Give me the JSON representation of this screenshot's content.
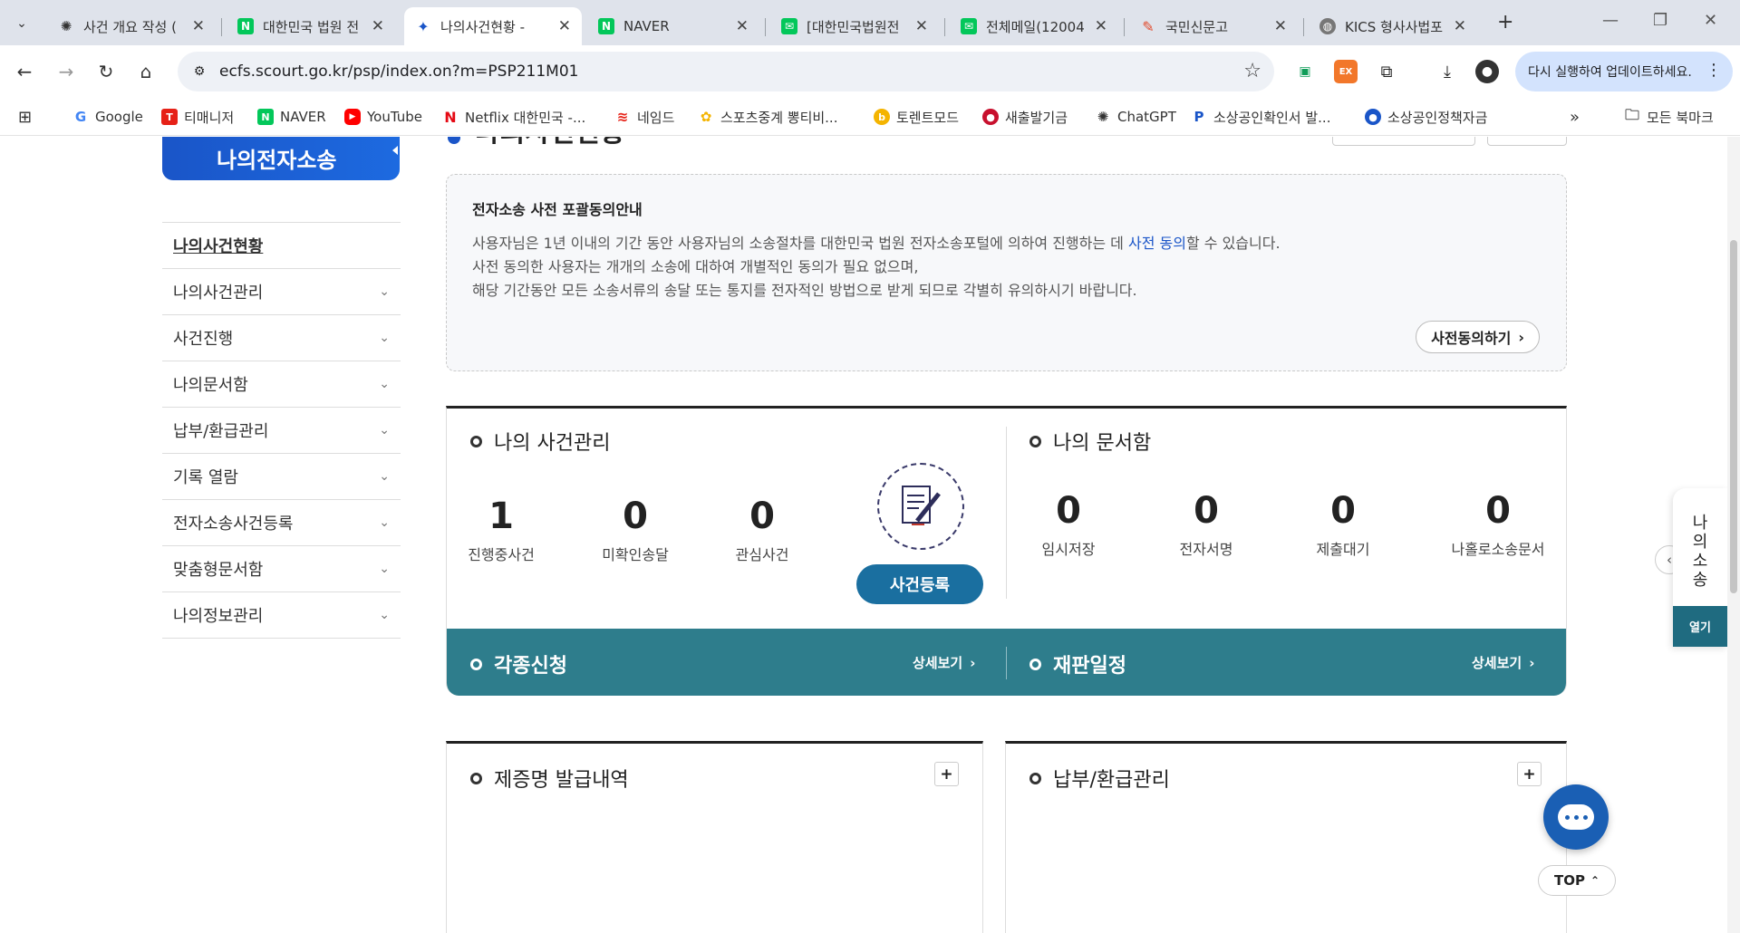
{
  "browser": {
    "tabs": [
      {
        "title": "사건 개요 작성 (",
        "icon": "openai-icon",
        "active": false
      },
      {
        "title": "대한민국 법원 전",
        "icon": "naver-n-icon",
        "active": false
      },
      {
        "title": "나의사건현황 - ",
        "icon": "court-logo-icon",
        "active": true
      },
      {
        "title": "NAVER",
        "icon": "naver-n-icon",
        "active": false
      },
      {
        "title": "[대한민국법원전",
        "icon": "naver-mail-icon",
        "active": false
      },
      {
        "title": "전체메일(12004",
        "icon": "naver-mail-icon",
        "active": false
      },
      {
        "title": "국민신문고",
        "icon": "petition-icon",
        "active": false
      },
      {
        "title": "KICS 형사사법포",
        "icon": "globe-icon",
        "active": false
      }
    ],
    "url": "ecfs.scourt.go.kr/psp/index.on?m=PSP211M01",
    "update_label": "다시 실행하여 업데이트하세요.",
    "bookmarks": [
      {
        "label": "Google",
        "icon": "google-icon"
      },
      {
        "label": "티매니저",
        "icon": "t-icon"
      },
      {
        "label": "NAVER",
        "icon": "naver-n-icon"
      },
      {
        "label": "YouTube",
        "icon": "youtube-icon"
      },
      {
        "label": "Netflix 대한민국 -...",
        "icon": "netflix-icon"
      },
      {
        "label": "네임드",
        "icon": "named-icon"
      },
      {
        "label": "스포츠중계 뽕티비...",
        "icon": "sports-icon"
      },
      {
        "label": "토렌트모드",
        "icon": "torrent-icon"
      },
      {
        "label": "새출발기금",
        "icon": "korea-emblem-icon"
      },
      {
        "label": "ChatGPT",
        "icon": "openai-icon"
      },
      {
        "label": "소상공인확인서 발...",
        "icon": "p-icon"
      },
      {
        "label": "소상공인정책자금",
        "icon": "policy-icon"
      }
    ],
    "all_bookmarks": "모든 북마크"
  },
  "sidebar": {
    "title": "나의전자소송",
    "items": [
      {
        "label": "나의사건현황",
        "current": true
      },
      {
        "label": "나의사건관리"
      },
      {
        "label": "사건진행"
      },
      {
        "label": "나의문서함"
      },
      {
        "label": "납부/환급관리"
      },
      {
        "label": "기록 열람"
      },
      {
        "label": "전자소송사건등록"
      },
      {
        "label": "맞춤형문서함"
      },
      {
        "label": "나의정보관리"
      }
    ]
  },
  "main": {
    "page_title": "나의사건현황",
    "consent": {
      "title": "전자소송 사전 포괄동의안내",
      "line1_pre": "사용자님은 1년 이내의 기간 동안 사용자님의 소송절차를 대한민국 법원 전자소송포털에 의하여 진행하는 데 ",
      "line1_link": "사전 동의",
      "line1_post": "할 수 있습니다.",
      "line2": "사전 동의한 사용자는 개개의 소송에 대하여 개별적인 동의가 필요 없으며,",
      "line3": "해당 기간동안 모든 소송서류의 송달 또는 통지를 전자적인 방법으로 받게 되므로 각별히 유의하시기 바랍니다.",
      "button": "사전동의하기"
    },
    "my_cases": {
      "title": "나의 사건관리",
      "stats": [
        {
          "value": "1",
          "label": "진행중사건"
        },
        {
          "value": "0",
          "label": "미확인송달"
        },
        {
          "value": "0",
          "label": "관심사건"
        }
      ],
      "register_button": "사건등록"
    },
    "my_docs": {
      "title": "나의 문서함",
      "stats": [
        {
          "value": "0",
          "label": "임시저장"
        },
        {
          "value": "0",
          "label": "전자서명"
        },
        {
          "value": "0",
          "label": "제출대기"
        },
        {
          "value": "0",
          "label": "나홀로소송문서"
        }
      ]
    },
    "bar": {
      "left_title": "각종신청",
      "right_title": "재판일정",
      "more": "상세보기"
    },
    "panels": {
      "certificate": "제증명 발급내역",
      "payment": "납부/환급관리"
    }
  },
  "floating": {
    "quick_label": "나의소송",
    "open": "열기",
    "top": "TOP"
  },
  "colors": {
    "brand_blue": "#1a55c8",
    "teal": "#2e7d8c",
    "button_blue": "#1a6fa0"
  }
}
